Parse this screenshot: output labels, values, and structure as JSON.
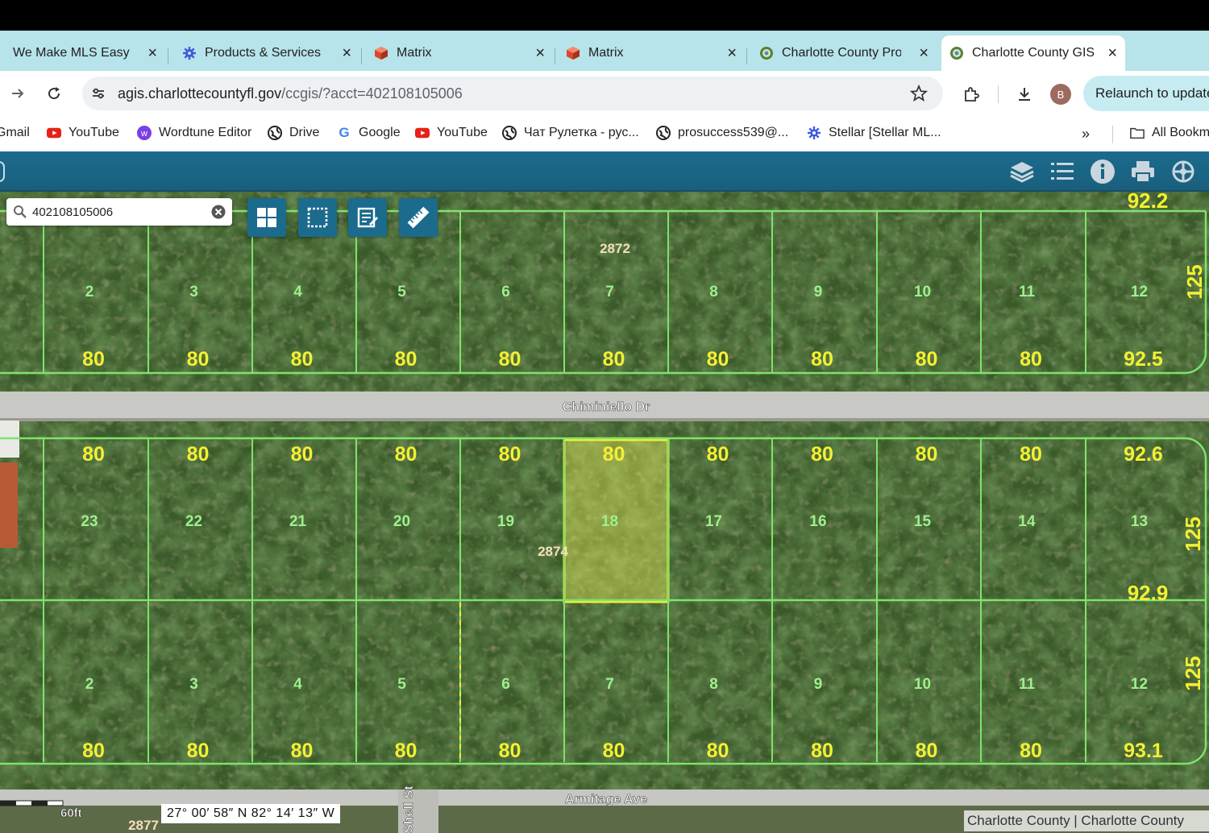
{
  "browser": {
    "tabs": [
      {
        "title": "We Make MLS Easy |",
        "icon": "mls-icon"
      },
      {
        "title": "Products & Services",
        "icon": "gear-badge-icon"
      },
      {
        "title": "Matrix",
        "icon": "matrix-icon"
      },
      {
        "title": "Matrix",
        "icon": "matrix-icon"
      },
      {
        "title": "Charlotte County Pro",
        "icon": "county-seal-icon"
      },
      {
        "title": "Charlotte County GIS",
        "icon": "county-seal-icon",
        "active": true
      }
    ],
    "address_bar": {
      "host": "agis.charlottecountyfl.gov",
      "path": "/ccgis/?acct=402108105006"
    },
    "profile_initial": "B",
    "relaunch_label": "Relaunch to update",
    "bookmarks": [
      {
        "label": "Gmail",
        "icon": "gmail-icon"
      },
      {
        "label": "YouTube",
        "icon": "youtube-icon"
      },
      {
        "label": "Wordtune Editor",
        "icon": "wordtune-icon"
      },
      {
        "label": "Drive",
        "icon": "globe-icon"
      },
      {
        "label": "Google",
        "icon": "google-icon"
      },
      {
        "label": "YouTube",
        "icon": "youtube-icon"
      },
      {
        "label": "Чат Рулетка - рус...",
        "icon": "globe-icon"
      },
      {
        "label": "prosuccess539@...",
        "icon": "globe-icon"
      },
      {
        "label": "Stellar [Stellar ML...",
        "icon": "gear-badge-icon"
      }
    ],
    "all_bookmarks_label": "All Bookmarks"
  },
  "gis": {
    "header_tools": [
      "layers-icon",
      "legend-list-icon",
      "info-icon",
      "print-icon",
      "tools-icon"
    ],
    "search": {
      "value": "402108105006"
    },
    "map_tools": [
      "basemap-grid-icon",
      "select-area-icon",
      "edit-notes-icon",
      "measure-ruler-icon"
    ],
    "scale_label": "60ft",
    "coordinates": "27° 00′ 58″ N 82° 14′ 13″ W",
    "attribution": "Charlotte County | Charlotte County",
    "roads": {
      "upper": "Chiminiello Dr",
      "lower": "Armitage Ave",
      "cross": "Shell St"
    },
    "address_labels": {
      "upper": "2872",
      "mid": "2874",
      "bottom": "2877"
    },
    "lot_numbers": {
      "top_row": [
        "2",
        "3",
        "4",
        "5",
        "6",
        "7",
        "8",
        "9",
        "10",
        "11",
        "12"
      ],
      "middle_row": [
        "23",
        "22",
        "21",
        "20",
        "19",
        "18",
        "17",
        "16",
        "15",
        "14",
        "13"
      ],
      "bottom_row": [
        "2",
        "3",
        "4",
        "5",
        "6",
        "7",
        "8",
        "9",
        "10",
        "11",
        "12"
      ]
    },
    "frontage": {
      "top_row": [
        "80",
        "80",
        "80",
        "80",
        "80",
        "80",
        "80",
        "80",
        "80",
        "80",
        "92.5"
      ],
      "middle_row": [
        "80",
        "80",
        "80",
        "80",
        "80",
        "80",
        "80",
        "80",
        "80",
        "80",
        "92.6"
      ],
      "bottom_row": [
        "80",
        "80",
        "80",
        "80",
        "80",
        "80",
        "80",
        "80",
        "80",
        "80",
        "93.1"
      ]
    },
    "side_dims": {
      "top_edge": "92.2",
      "top_depth": "125",
      "mid_depth": "125",
      "mid_rear": "92.9",
      "bottom_depth": "125"
    },
    "selected_parcel_lot": "18",
    "colors": {
      "header": "#1b6b8d",
      "parcel_line": "#7fe36b",
      "dimension_text": "#f4f032",
      "selected": "#f4f032"
    }
  }
}
